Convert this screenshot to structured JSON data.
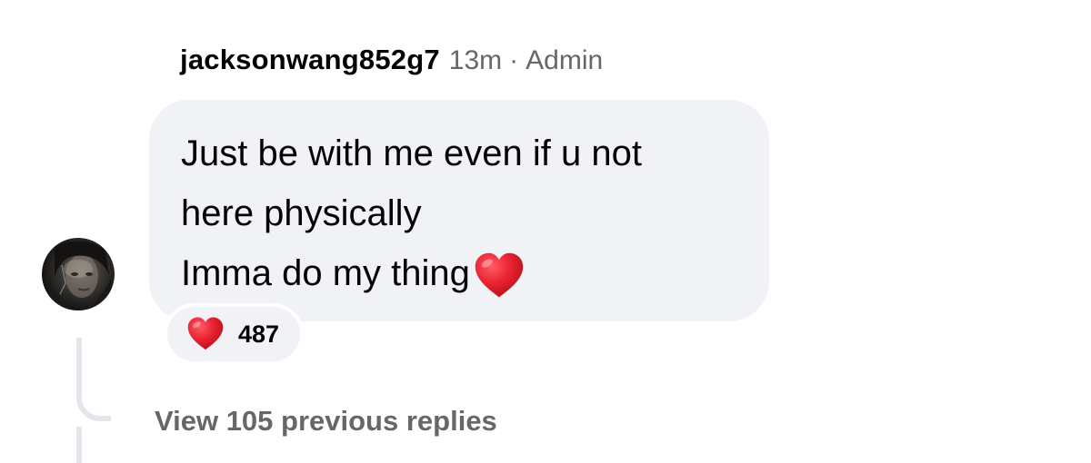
{
  "comment": {
    "author": "jacksonwang852g7",
    "time": "13m",
    "separator": "·",
    "role": "Admin",
    "lines": [
      "Just be with me even if u not",
      "here physically",
      "Imma do my thing"
    ],
    "inline_emoji": "red-heart"
  },
  "reactions": {
    "icon": "red-heart",
    "count": "487"
  },
  "replies": {
    "link_label": "View 105 previous replies"
  },
  "colors": {
    "bubble": "#f0f2f5",
    "meta_text": "#65676b",
    "heart": "#e8202f",
    "thread_line": "#e4e6eb"
  }
}
